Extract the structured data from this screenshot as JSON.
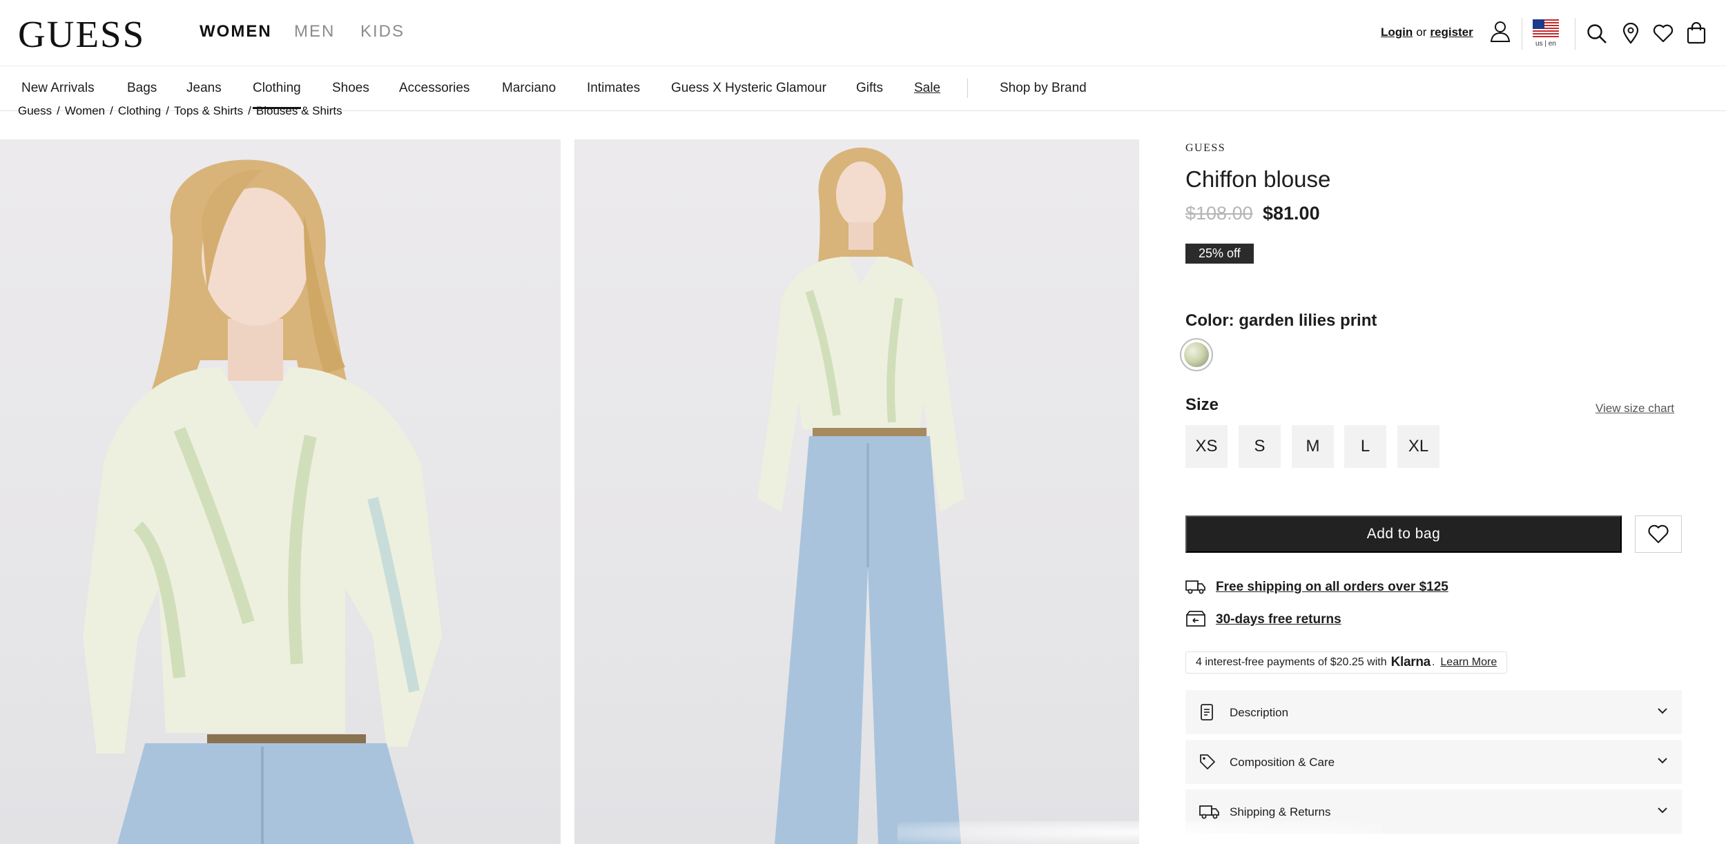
{
  "header": {
    "logo": "GUESS",
    "departments": [
      "WOMEN",
      "MEN",
      "KIDS"
    ],
    "login_label": "Login",
    "or_label": "or",
    "register_label": "register",
    "locale_label": "us | en"
  },
  "nav": {
    "categories": [
      "New Arrivals",
      "Bags",
      "Jeans",
      "Clothing",
      "Shoes",
      "Accessories",
      "Marciano",
      "Intimates",
      "Guess X Hysteric Glamour",
      "Gifts",
      "Sale"
    ],
    "active": "Clothing",
    "shop_by_brand": "Shop by Brand"
  },
  "breadcrumb": [
    "Guess",
    "Women",
    "Clothing",
    "Tops & Shirts",
    "Blouses & Shirts"
  ],
  "product": {
    "brand": "GUESS",
    "title": "Chiffon blouse",
    "price_original": "$108.00",
    "price_sale": "$81.00",
    "discount_badge": "25% off",
    "color_label": "Color: garden lilies print",
    "size_label": "Size",
    "size_chart_label": "View size chart",
    "sizes": [
      "XS",
      "S",
      "M",
      "L",
      "XL"
    ],
    "add_to_bag_label": "Add to bag",
    "perks": [
      "Free shipping on all orders over $125",
      "30-days free returns"
    ],
    "klarna": {
      "prefix": "4 interest-free payments of $20.25 with",
      "brand": "Klarna",
      "learn_more": "Learn More"
    },
    "accordions": [
      "Description",
      "Composition & Care",
      "Shipping & Returns"
    ]
  },
  "colors": {
    "accent": "#222222",
    "price_muted": "#b5b5b5",
    "accordion_bg": "#f6f6f6"
  },
  "icons": [
    "user-icon",
    "us-flag-icon",
    "search-icon",
    "store-locator-icon",
    "heart-icon",
    "bag-icon",
    "truck-icon",
    "returns-box-icon",
    "document-icon",
    "tag-icon",
    "shipping-truck-icon",
    "chevron-down-icon"
  ]
}
